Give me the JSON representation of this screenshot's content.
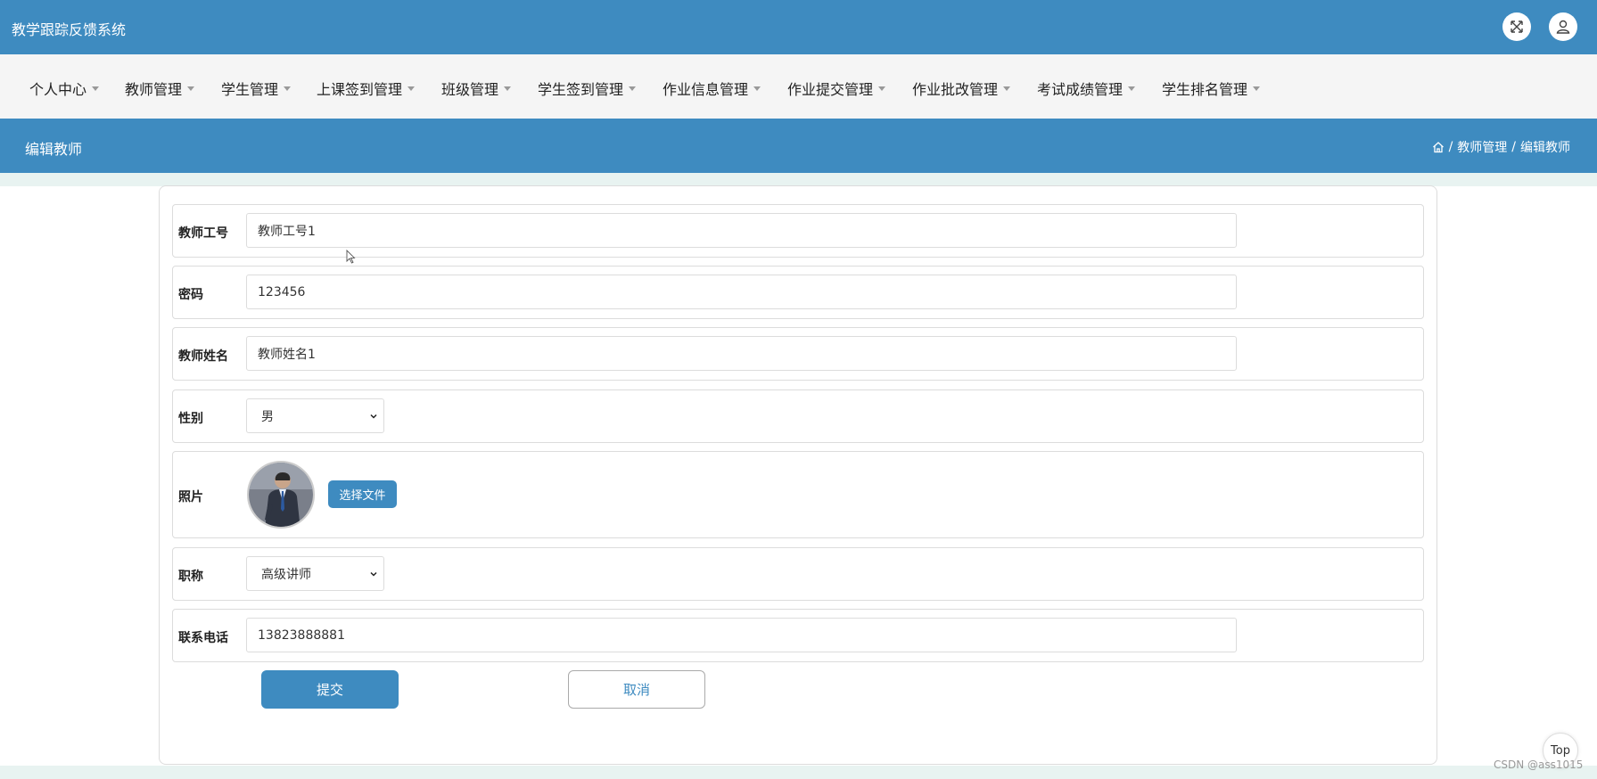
{
  "app": {
    "title": "教学跟踪反馈系统"
  },
  "topbar": {
    "fullscreen_icon": "fullscreen-icon",
    "user_icon": "user-icon"
  },
  "nav": {
    "items": [
      {
        "label": "个人中心"
      },
      {
        "label": "教师管理"
      },
      {
        "label": "学生管理"
      },
      {
        "label": "上课签到管理"
      },
      {
        "label": "班级管理"
      },
      {
        "label": "学生签到管理"
      },
      {
        "label": "作业信息管理"
      },
      {
        "label": "作业提交管理"
      },
      {
        "label": "作业批改管理"
      },
      {
        "label": "考试成绩管理"
      },
      {
        "label": "学生排名管理"
      }
    ]
  },
  "page": {
    "title": "编辑教师",
    "breadcrumb": {
      "sep": "/",
      "parent": "教师管理",
      "current": "编辑教师"
    }
  },
  "form": {
    "teacher_id": {
      "label": "教师工号",
      "value": "教师工号1"
    },
    "password": {
      "label": "密码",
      "value": "123456"
    },
    "teacher_name": {
      "label": "教师姓名",
      "value": "教师姓名1"
    },
    "gender": {
      "label": "性别",
      "value": "男"
    },
    "photo": {
      "label": "照片",
      "button": "选择文件"
    },
    "title": {
      "label": "职称",
      "value": "高级讲师"
    },
    "phone": {
      "label": "联系电话",
      "value": "13823888881"
    },
    "submit": "提交",
    "cancel": "取消"
  },
  "footer": {
    "top_button": "Top",
    "watermark": "CSDN @ass1015"
  },
  "colors": {
    "primary": "#3e8bc0",
    "nav_bg": "#f5f5f5",
    "page_bg": "#e8f3f1"
  }
}
